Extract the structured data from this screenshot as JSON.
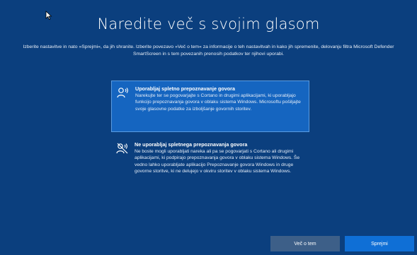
{
  "page": {
    "title": "Naredite več s svojim glasom",
    "subtitle": "Izberite nastavitve in nato »Sprejmi«, da jih shranite. Izberite povezavo »Več o tem« za informacije o teh nastavitvah in kako jih spremenite, delovanju filtra Microsoft Defender SmartScreen in s tem povezanih prenosih podatkov ter njihovi uporabi."
  },
  "options": [
    {
      "title": "Uporabljaj spletno prepoznavanje govora",
      "description": "Narekujte ter se pogovarjajte s Cortano in drugimi aplikacijami, ki uporabljajo funkcijo prepoznavanja govora v oblaku sistema Windows. Microsoftu pošiljajte svoje glasovne podatke za izboljšanje govornih storitev.",
      "selected": true,
      "icon": "speech-recognition-icon"
    },
    {
      "title": "Ne uporabljaj spletnega prepoznavanja govora",
      "description": "Ne boste mogli uporabljati nareka ali pa se pogovarjati s Cortano ali drugimi aplikacijami, ki podpirajo prepoznavanja govora v oblaku sistema Windows. Še vedno lahko uporabljate aplikacijo Prepoznavanje govora Windows in druge govorne storitve, ki ne delujejo v okviru storitev v oblaku sistema Windows.",
      "selected": false,
      "icon": "speech-recognition-off-icon"
    }
  ],
  "buttons": {
    "learn_more": "Več o tem",
    "accept": "Sprejmi"
  },
  "colors": {
    "background": "#0b3f7e",
    "selected_option": "#1565c0",
    "accept_button": "#0f6fd6",
    "secondary_button": "#3d5f88"
  }
}
